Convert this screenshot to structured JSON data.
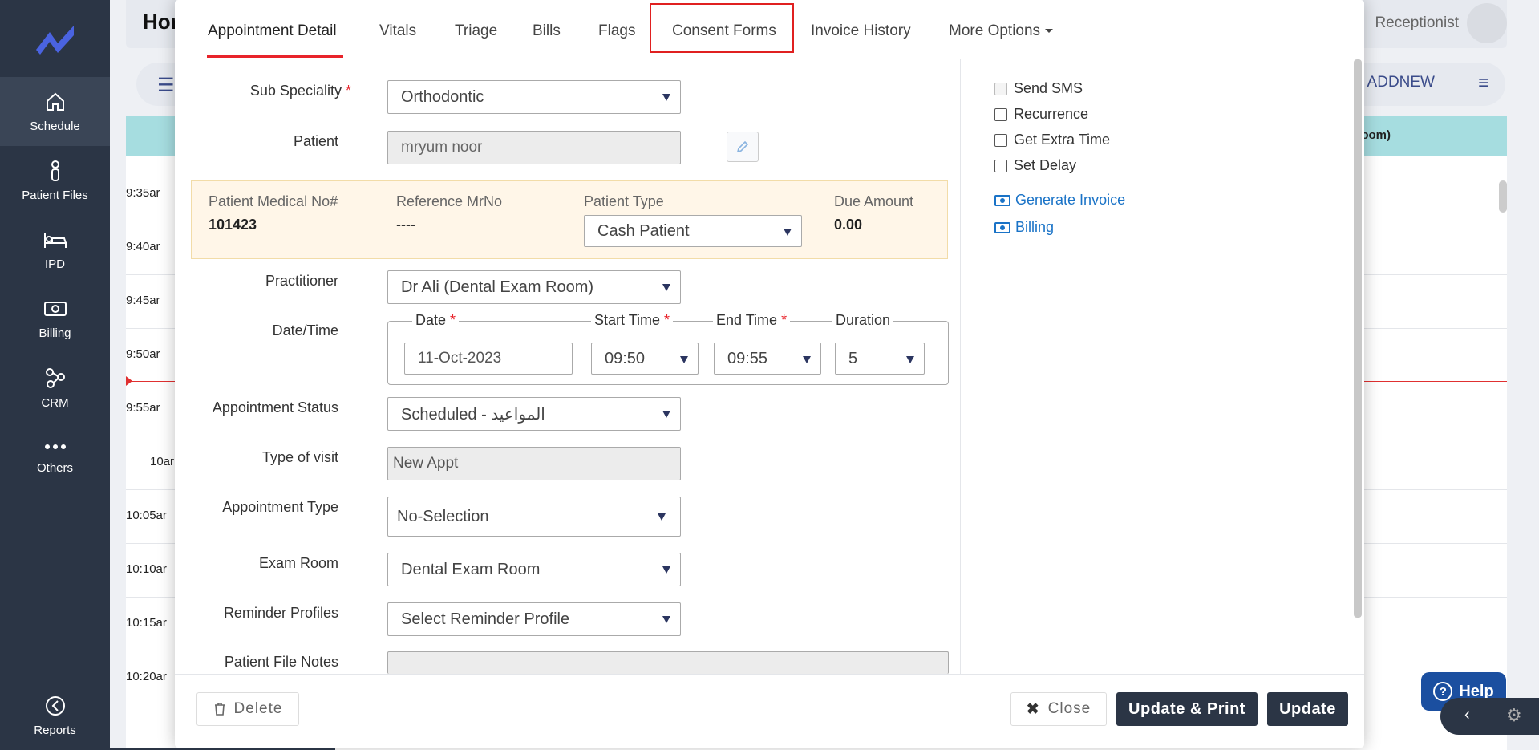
{
  "sidebar": {
    "items": [
      {
        "label": "Schedule"
      },
      {
        "label": "Patient Files"
      },
      {
        "label": "IPD"
      },
      {
        "label": "Billing"
      },
      {
        "label": "CRM"
      },
      {
        "label": "Others"
      }
    ],
    "bottom": {
      "label": "Reports"
    }
  },
  "background": {
    "title": "Hor",
    "user": "Receptionist",
    "addnew": "ADDNEW",
    "room_header": "oom)",
    "time_slots": [
      "9:35ar",
      "9:40ar",
      "9:45ar",
      "9:50ar",
      "9:55ar",
      "10ar",
      "10:05ar",
      "10:10ar",
      "10:15ar",
      "10:20ar"
    ]
  },
  "tabs": [
    {
      "label": "Appointment Detail"
    },
    {
      "label": "Vitals"
    },
    {
      "label": "Triage"
    },
    {
      "label": "Bills"
    },
    {
      "label": "Flags"
    },
    {
      "label": "Consent Forms"
    },
    {
      "label": "Invoice History"
    },
    {
      "label": "More Options"
    }
  ],
  "form": {
    "sub_speciality": {
      "label": "Sub Speciality",
      "value": "Orthodontic"
    },
    "patient": {
      "label": "Patient",
      "value": "mryum  noor"
    },
    "info": {
      "mrn_label": "Patient Medical No#",
      "mrn_value": "101423",
      "ref_label": "Reference MrNo",
      "ref_value": "----",
      "type_label": "Patient Type",
      "type_value": "Cash Patient",
      "due_label": "Due Amount",
      "due_value": "0.00"
    },
    "practitioner": {
      "label": "Practitioner",
      "value": "Dr Ali (Dental Exam Room)"
    },
    "datetime": {
      "label": "Date/Time",
      "date_label": "Date",
      "date_value": "11-Oct-2023",
      "start_label": "Start Time",
      "start_value": "09:50",
      "end_label": "End Time",
      "end_value": "09:55",
      "duration_label": "Duration",
      "duration_value": "5"
    },
    "status": {
      "label": "Appointment Status",
      "value": "Scheduled - المواعيد"
    },
    "visit_type": {
      "label": "Type of visit",
      "value": "New Appt"
    },
    "appt_type": {
      "label": "Appointment Type",
      "value": "No-Selection"
    },
    "exam_room": {
      "label": "Exam Room",
      "value": "Dental Exam Room"
    },
    "reminder": {
      "label": "Reminder Profiles",
      "value": "Select Reminder Profile"
    },
    "notes": {
      "label": "Patient File Notes"
    }
  },
  "options": {
    "send_sms": "Send SMS",
    "recurrence": "Recurrence",
    "extra_time": "Get Extra Time",
    "set_delay": "Set Delay",
    "generate_invoice": "Generate Invoice",
    "billing": "Billing"
  },
  "footer": {
    "delete": "Delete",
    "close": "Close",
    "update_print": "Update & Print",
    "update": "Update"
  },
  "help": {
    "label": "Help"
  },
  "colors": {
    "sidebar": "#2b3545",
    "accent_red": "#e8232a",
    "link": "#1a73c7",
    "info_bg": "#fff6e8"
  }
}
